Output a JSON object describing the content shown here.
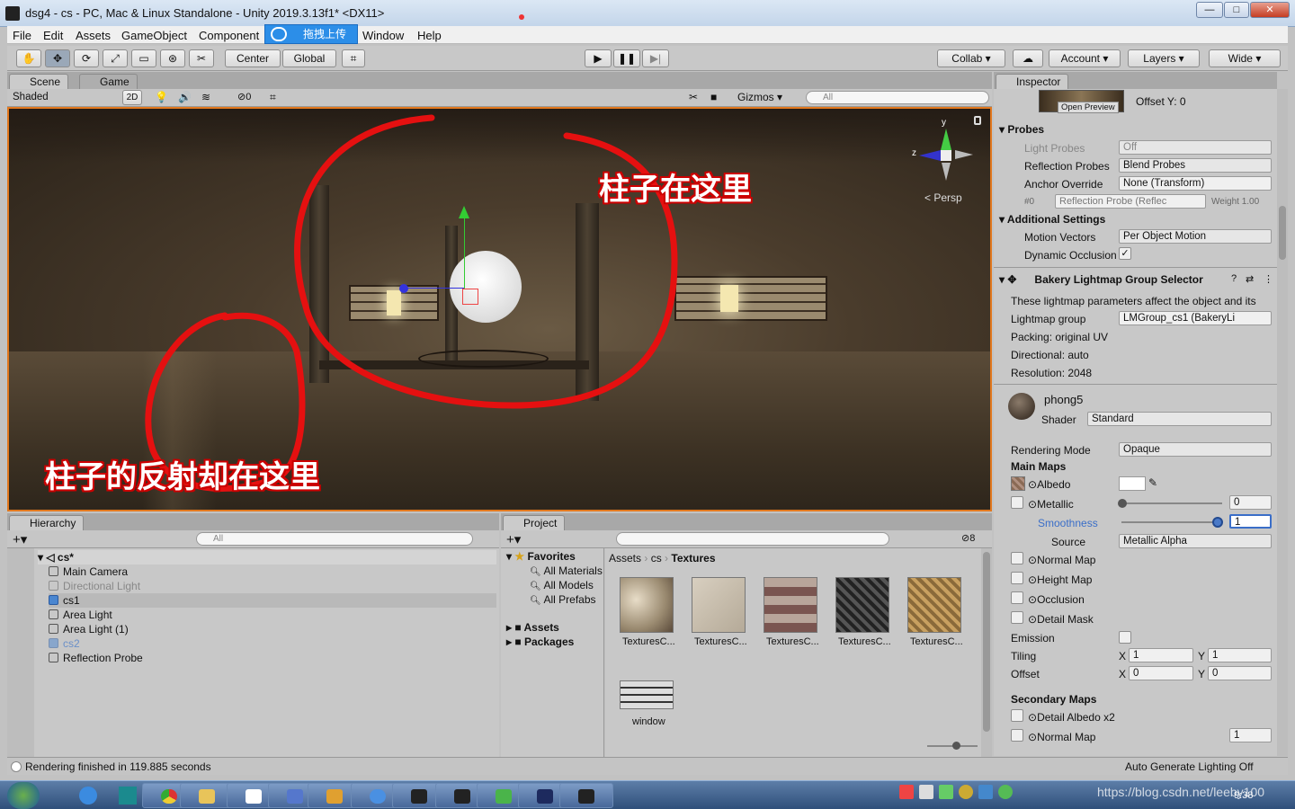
{
  "window": {
    "title": "dsg4 - cs - PC, Mac & Linux Standalone - Unity 2019.3.13f1* <DX11>",
    "minimize": "—",
    "maximize": "□",
    "close": "✕"
  },
  "menu": [
    "File",
    "Edit",
    "Assets",
    "GameObject",
    "Component",
    "Window",
    "Help"
  ],
  "baidu_button": "拖拽上传",
  "toolbar": {
    "center": "Center",
    "global": "Global",
    "collab": "Collab",
    "account": "Account",
    "layers": "Layers",
    "layout": "Wide"
  },
  "scene": {
    "tab_scene": "Scene",
    "tab_game": "Game",
    "shading": "Shaded",
    "mode_2d": "2D",
    "hidden_count": "0",
    "gizmos": "Gizmos",
    "search_placeholder": "All",
    "persp": "< Persp",
    "gizmo_axes": {
      "y": "y",
      "z": "z"
    },
    "annotation_top": "柱子在这里",
    "annotation_bottom": "柱子的反射却在这里"
  },
  "hierarchy": {
    "title": "Hierarchy",
    "search_placeholder": "All",
    "scene_name": "cs*",
    "items": [
      {
        "label": "Main Camera",
        "dim": false
      },
      {
        "label": "Directional Light",
        "dim": true
      },
      {
        "label": "cs1",
        "dim": false
      },
      {
        "label": "Area Light",
        "dim": false
      },
      {
        "label": "Area Light (1)",
        "dim": false
      },
      {
        "label": "cs2",
        "dim": true
      },
      {
        "label": "Reflection Probe",
        "dim": false
      }
    ]
  },
  "project": {
    "title": "Project",
    "count": "8",
    "favorites_label": "Favorites",
    "favorites": [
      "All Materials",
      "All Models",
      "All Prefabs"
    ],
    "roots": [
      "Assets",
      "Packages"
    ],
    "breadcrumb": [
      "Assets",
      "cs",
      "Textures"
    ],
    "assets": [
      "TexturesC...",
      "TexturesC...",
      "TexturesC...",
      "TexturesC...",
      "TexturesC...",
      "window"
    ]
  },
  "inspector": {
    "title": "Inspector",
    "open_preview": "Open Preview",
    "offset_y": "Offset Y: 0",
    "probes_header": "Probes",
    "light_probes_label": "Light Probes",
    "light_probes_value": "Off",
    "reflection_probes_label": "Reflection Probes",
    "reflection_probes_value": "Blend Probes",
    "anchor_override_label": "Anchor Override",
    "anchor_override_value": "None (Transform)",
    "probe_index": "#0",
    "probe_ref": "Reflection Probe (Reflec",
    "probe_weight": "Weight 1.00",
    "additional_header": "Additional Settings",
    "motion_vectors_label": "Motion Vectors",
    "motion_vectors_value": "Per Object Motion",
    "dynamic_occlusion_label": "Dynamic Occlusion",
    "bakery_header": "Bakery Lightmap Group Selector",
    "bakery_desc": "These lightmap parameters affect the object and its",
    "lightmap_group_label": "Lightmap group",
    "lightmap_group_value": "LMGroup_cs1 (BakeryLi",
    "packing": "Packing: original UV",
    "directional": "Directional: auto",
    "resolution": "Resolution: 2048",
    "material_name": "phong5",
    "shader_label": "Shader",
    "shader_value": "Standard",
    "rendering_mode_label": "Rendering Mode",
    "rendering_mode_value": "Opaque",
    "main_maps": "Main Maps",
    "albedo": "Albedo",
    "metallic": "Metallic",
    "metallic_value": "0",
    "smoothness": "Smoothness",
    "smoothness_value": "1",
    "source_label": "Source",
    "source_value": "Metallic Alpha",
    "normal_map": "Normal Map",
    "height_map": "Height Map",
    "occlusion": "Occlusion",
    "detail_mask": "Detail Mask",
    "emission": "Emission",
    "tiling": "Tiling",
    "offset": "Offset",
    "tiling_x": "1",
    "tiling_y": "1",
    "offset_x": "0",
    "offset_y_val": "0",
    "secondary_maps": "Secondary Maps",
    "detail_albedo": "Detail Albedo x2",
    "normal_map2": "Normal Map",
    "normal_map2_value": "1",
    "x": "X",
    "y": "Y"
  },
  "status": {
    "left": "Rendering finished in 119.885 seconds",
    "right": "Auto Generate Lighting Off"
  },
  "taskbar": {
    "watermark": "https://blog.csdn.net/leeby100",
    "clock": "9:38"
  }
}
